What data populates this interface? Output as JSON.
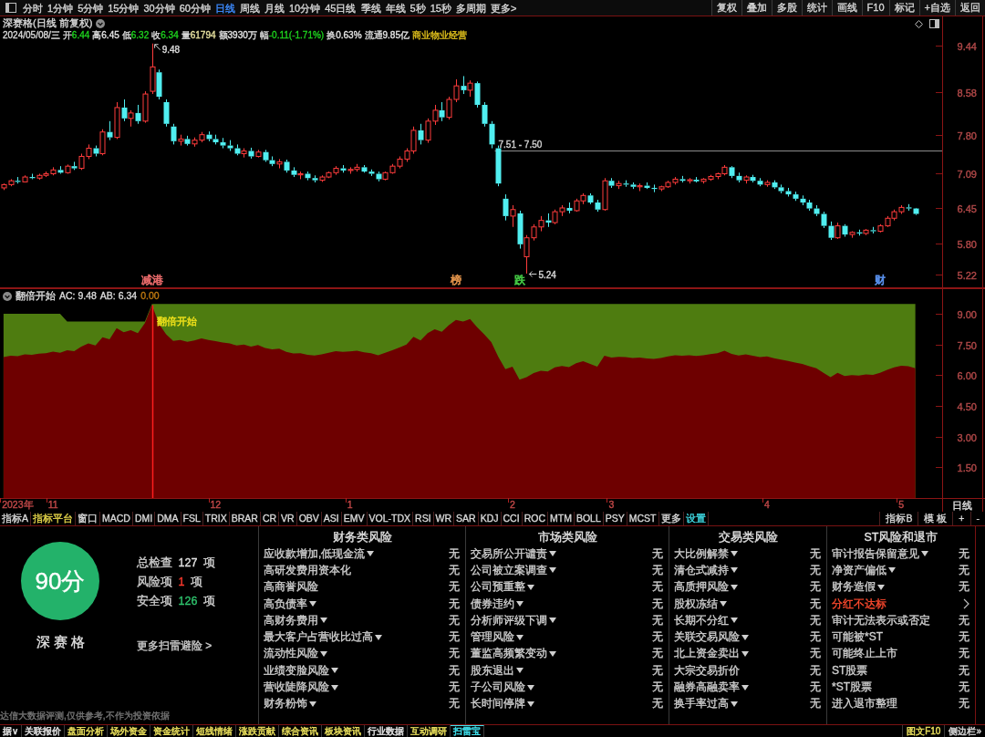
{
  "toolbar": {
    "periods": [
      {
        "label": "分时",
        "selected": false
      },
      {
        "label": "1分钟",
        "selected": false
      },
      {
        "label": "5分钟",
        "selected": false
      },
      {
        "label": "15分钟",
        "selected": false
      },
      {
        "label": "30分钟",
        "selected": false
      },
      {
        "label": "60分钟",
        "selected": false
      },
      {
        "label": "日线",
        "selected": true
      },
      {
        "label": "周线",
        "selected": false
      },
      {
        "label": "月线",
        "selected": false
      },
      {
        "label": "10分钟",
        "selected": false
      },
      {
        "label": "45日线",
        "selected": false
      },
      {
        "label": "季线",
        "selected": false
      },
      {
        "label": "年线",
        "selected": false
      },
      {
        "label": "5秒",
        "selected": false
      },
      {
        "label": "15秒",
        "selected": false
      },
      {
        "label": "多周期",
        "selected": false
      },
      {
        "label": "更多>",
        "selected": false
      }
    ],
    "buttons": [
      "复权",
      "叠加",
      "多股",
      "统计",
      "画线",
      "F10",
      "标记",
      "+自选",
      "返回"
    ]
  },
  "chart_header": {
    "title": "深赛格(日线 前复权)",
    "date": "2024/05/08/三",
    "quotes": [
      {
        "label": "开",
        "value": "6.44",
        "color": "#1ed21e"
      },
      {
        "label": "高",
        "value": "6.45",
        "color": "#e6e6e6"
      },
      {
        "label": "低",
        "value": "6.32",
        "color": "#1ed21e"
      },
      {
        "label": "收",
        "value": "6.34",
        "color": "#1ed21e"
      },
      {
        "label": "量",
        "value": "61794",
        "color": "#e8e2a0"
      },
      {
        "label": "额",
        "value": "3930万",
        "color": "#e6e6e6"
      },
      {
        "label": "幅",
        "value": "-0.11(-1.71%)",
        "color": "#1ed21e"
      },
      {
        "label": "换",
        "value": "0.63%",
        "color": "#e6e6e6"
      },
      {
        "label": "流通",
        "value": "9.85亿",
        "color": "#e6e6e6"
      }
    ],
    "industry": "商业物业经营"
  },
  "price_chart": {
    "chart_data": {
      "type": "candlestick",
      "ylim": [
        4.97,
        9.98
      ],
      "yticks": [
        9.44,
        8.58,
        {
          "value": 7.8,
          "label": "7.80"
        },
        7.09,
        6.45,
        {
          "value": 5.8,
          "label": "5.80"
        },
        5.22
      ],
      "categories": [
        null,
        null,
        null,
        null,
        null,
        null,
        null,
        null,
        null,
        null,
        null,
        null,
        null,
        null,
        null,
        null,
        null,
        null,
        null,
        null,
        null,
        "减港",
        null,
        null,
        null,
        null,
        null,
        null,
        null,
        null,
        null,
        null,
        null,
        null,
        null,
        null,
        null,
        null,
        null,
        null,
        null,
        null,
        null,
        null,
        null,
        null,
        null,
        null,
        null,
        null,
        null,
        null,
        null,
        null,
        null,
        null,
        null,
        null,
        null,
        null,
        null,
        null,
        null,
        null,
        "榜",
        null,
        null,
        null,
        null,
        null,
        null,
        null,
        null,
        "跌",
        null,
        null,
        null,
        null,
        null,
        null,
        null,
        null,
        null,
        null,
        null,
        null,
        null,
        null,
        null,
        null,
        null,
        null,
        null,
        null,
        null,
        null,
        null,
        null,
        null,
        null,
        null,
        null,
        null,
        null,
        null,
        null,
        null,
        null,
        null,
        null,
        null,
        null,
        null,
        null,
        null,
        null,
        null,
        null,
        null,
        null,
        null,
        null,
        null,
        null,
        "财",
        null,
        null,
        null,
        null,
        null
      ],
      "ohlc": [
        [
          6.82,
          6.9,
          6.78,
          6.88
        ],
        [
          6.88,
          6.98,
          6.85,
          6.95
        ],
        [
          6.95,
          7.02,
          6.9,
          6.93
        ],
        [
          6.93,
          7.05,
          6.92,
          7.02
        ],
        [
          7.02,
          7.08,
          6.98,
          7.0
        ],
        [
          7.0,
          7.08,
          6.97,
          7.05
        ],
        [
          7.05,
          7.12,
          7.02,
          7.08
        ],
        [
          7.08,
          7.2,
          7.05,
          7.15
        ],
        [
          7.15,
          7.22,
          7.08,
          7.1
        ],
        [
          7.1,
          7.25,
          7.08,
          7.22
        ],
        [
          7.22,
          7.3,
          7.15,
          7.18
        ],
        [
          7.18,
          7.45,
          7.15,
          7.4
        ],
        [
          7.4,
          7.62,
          7.35,
          7.55
        ],
        [
          7.55,
          7.6,
          7.4,
          7.45
        ],
        [
          7.45,
          7.9,
          7.42,
          7.85
        ],
        [
          7.85,
          8.05,
          7.7,
          7.75
        ],
        [
          7.75,
          8.4,
          7.72,
          8.3
        ],
        [
          8.3,
          8.45,
          8.05,
          8.1
        ],
        [
          8.1,
          8.25,
          7.95,
          8.2
        ],
        [
          8.2,
          8.35,
          8.0,
          8.05
        ],
        [
          8.05,
          8.6,
          8.02,
          8.55
        ],
        [
          8.6,
          9.48,
          8.55,
          9.05
        ],
        [
          8.95,
          9.0,
          8.45,
          8.5
        ],
        [
          8.4,
          8.45,
          7.95,
          8.0
        ],
        [
          7.95,
          8.0,
          7.62,
          7.68
        ],
        [
          7.68,
          7.8,
          7.6,
          7.72
        ],
        [
          7.72,
          7.78,
          7.6,
          7.63
        ],
        [
          7.63,
          7.75,
          7.58,
          7.7
        ],
        [
          7.7,
          7.85,
          7.66,
          7.8
        ],
        [
          7.8,
          7.86,
          7.68,
          7.72
        ],
        [
          7.72,
          7.8,
          7.62,
          7.66
        ],
        [
          7.66,
          7.74,
          7.55,
          7.6
        ],
        [
          7.6,
          7.7,
          7.5,
          7.55
        ],
        [
          7.55,
          7.62,
          7.42,
          7.45
        ],
        [
          7.45,
          7.55,
          7.38,
          7.5
        ],
        [
          7.5,
          7.56,
          7.36,
          7.4
        ],
        [
          7.4,
          7.52,
          7.38,
          7.48
        ],
        [
          7.48,
          7.52,
          7.3,
          7.33
        ],
        [
          7.33,
          7.4,
          7.22,
          7.26
        ],
        [
          7.26,
          7.35,
          7.18,
          7.3
        ],
        [
          7.3,
          7.34,
          7.1,
          7.14
        ],
        [
          7.14,
          7.2,
          7.02,
          7.06
        ],
        [
          7.06,
          7.12,
          6.98,
          7.08
        ],
        [
          7.08,
          7.12,
          6.96,
          7.0
        ],
        [
          7.0,
          7.05,
          6.92,
          6.96
        ],
        [
          6.96,
          7.05,
          6.93,
          7.02
        ],
        [
          7.02,
          7.12,
          7.0,
          7.1
        ],
        [
          7.1,
          7.22,
          7.06,
          7.18
        ],
        [
          7.18,
          7.24,
          7.1,
          7.14
        ],
        [
          7.14,
          7.2,
          7.08,
          7.16
        ],
        [
          7.16,
          7.26,
          7.12,
          7.2
        ],
        [
          7.2,
          7.24,
          7.1,
          7.12
        ],
        [
          7.12,
          7.16,
          7.04,
          7.08
        ],
        [
          7.08,
          7.12,
          6.94,
          6.98
        ],
        [
          6.98,
          7.12,
          6.96,
          7.1
        ],
        [
          7.1,
          7.26,
          7.08,
          7.22
        ],
        [
          7.22,
          7.4,
          7.18,
          7.35
        ],
        [
          7.35,
          7.55,
          7.3,
          7.5
        ],
        [
          7.5,
          7.95,
          7.45,
          7.88
        ],
        [
          7.88,
          8.0,
          7.62,
          7.7
        ],
        [
          7.7,
          8.1,
          7.65,
          8.05
        ],
        [
          8.05,
          8.35,
          7.98,
          8.25
        ],
        [
          8.25,
          8.4,
          8.05,
          8.12
        ],
        [
          8.12,
          8.5,
          8.08,
          8.45
        ],
        [
          8.45,
          8.82,
          8.4,
          8.7
        ],
        [
          8.7,
          8.88,
          8.55,
          8.62
        ],
        [
          8.62,
          8.8,
          8.5,
          8.75
        ],
        [
          8.75,
          8.78,
          8.3,
          8.35
        ],
        [
          8.35,
          8.4,
          7.95,
          8.0
        ],
        [
          8.0,
          8.05,
          7.55,
          7.62
        ],
        [
          7.55,
          7.6,
          6.85,
          6.9
        ],
        [
          6.62,
          6.7,
          6.22,
          6.3
        ],
        [
          6.3,
          6.5,
          6.1,
          6.42
        ],
        [
          6.35,
          6.4,
          5.7,
          5.78
        ],
        [
          5.55,
          5.95,
          5.24,
          5.9
        ],
        [
          5.9,
          6.15,
          5.85,
          6.1
        ],
        [
          6.1,
          6.3,
          6.02,
          6.22
        ],
        [
          6.22,
          6.35,
          6.1,
          6.18
        ],
        [
          6.18,
          6.42,
          6.15,
          6.38
        ],
        [
          6.38,
          6.5,
          6.3,
          6.45
        ],
        [
          6.45,
          6.55,
          6.35,
          6.4
        ],
        [
          6.4,
          6.62,
          6.38,
          6.58
        ],
        [
          6.58,
          6.72,
          6.52,
          6.68
        ],
        [
          6.68,
          6.72,
          6.52,
          6.55
        ],
        [
          6.55,
          6.6,
          6.38,
          6.42
        ],
        [
          6.42,
          7.0,
          6.4,
          6.95
        ],
        [
          6.95,
          7.0,
          6.82,
          6.86
        ],
        [
          6.86,
          6.95,
          6.8,
          6.9
        ],
        [
          6.9,
          6.96,
          6.84,
          6.88
        ],
        [
          6.88,
          6.92,
          6.8,
          6.84
        ],
        [
          6.84,
          6.9,
          6.76,
          6.86
        ],
        [
          6.86,
          6.92,
          6.8,
          6.82
        ],
        [
          6.82,
          6.88,
          6.74,
          6.8
        ],
        [
          6.8,
          6.86,
          6.76,
          6.84
        ],
        [
          6.84,
          6.95,
          6.82,
          6.92
        ],
        [
          6.92,
          7.02,
          6.88,
          6.98
        ],
        [
          6.98,
          7.04,
          6.92,
          6.95
        ],
        [
          6.95,
          7.0,
          6.9,
          6.97
        ],
        [
          6.97,
          7.02,
          6.92,
          6.94
        ],
        [
          6.94,
          7.0,
          6.9,
          6.98
        ],
        [
          6.98,
          7.06,
          6.95,
          7.03
        ],
        [
          7.03,
          7.1,
          6.98,
          7.08
        ],
        [
          7.08,
          7.24,
          7.05,
          7.2
        ],
        [
          7.2,
          7.22,
          7.0,
          7.04
        ],
        [
          7.04,
          7.1,
          6.92,
          6.96
        ],
        [
          6.96,
          7.05,
          6.9,
          7.02
        ],
        [
          7.02,
          7.06,
          6.92,
          6.95
        ],
        [
          6.95,
          7.0,
          6.85,
          6.88
        ],
        [
          6.88,
          6.96,
          6.84,
          6.92
        ],
        [
          6.92,
          6.96,
          6.8,
          6.83
        ],
        [
          6.83,
          6.88,
          6.72,
          6.76
        ],
        [
          6.76,
          6.82,
          6.66,
          6.7
        ],
        [
          6.7,
          6.75,
          6.58,
          6.62
        ],
        [
          6.62,
          6.68,
          6.5,
          6.55
        ],
        [
          6.55,
          6.6,
          6.4,
          6.44
        ],
        [
          6.44,
          6.5,
          6.3,
          6.34
        ],
        [
          6.34,
          6.38,
          6.08,
          6.12
        ],
        [
          6.12,
          6.2,
          5.86,
          5.9
        ],
        [
          5.9,
          6.18,
          5.88,
          6.12
        ],
        [
          6.12,
          6.15,
          5.92,
          5.96
        ],
        [
          5.96,
          6.02,
          5.9,
          6.0
        ],
        [
          6.0,
          6.05,
          5.94,
          5.98
        ],
        [
          5.98,
          6.06,
          5.95,
          6.04
        ],
        [
          6.04,
          6.1,
          5.98,
          6.02
        ],
        [
          6.02,
          6.15,
          6.0,
          6.12
        ],
        [
          6.12,
          6.3,
          6.1,
          6.26
        ],
        [
          6.26,
          6.42,
          6.22,
          6.38
        ],
        [
          6.38,
          6.5,
          6.34,
          6.46
        ],
        [
          6.46,
          6.52,
          6.4,
          6.44
        ],
        [
          6.44,
          6.45,
          6.32,
          6.34
        ]
      ],
      "ref_lines": [
        {
          "axis": "y",
          "value": 7.51,
          "label": "7.51 - 7.50",
          "color": "#8c8c8c"
        }
      ],
      "annotations": [
        "9.48",
        "5.24"
      ]
    },
    "event_markers": [
      {
        "color": "#e86a6a"
      },
      {
        "color": "#e0924a"
      },
      {
        "color": "#44c844"
      },
      {
        "color": "#5a92f0"
      }
    ]
  },
  "indicator": {
    "name": "翻倍开始",
    "readouts": [
      {
        "text": "AC: 9.48",
        "color": "#dcdcdc"
      },
      {
        "text": "AB: 6.34",
        "color": "#dcdcdc"
      },
      {
        "text": "0.00",
        "color": "#c07a10"
      }
    ],
    "chart_data": {
      "type": "area",
      "ylim": [
        0,
        10.25
      ],
      "yticks": [
        {
          "value": 9,
          "label": "9.00"
        },
        {
          "value": 7.5,
          "label": "7.50"
        },
        {
          "value": 6,
          "label": "6.00"
        },
        {
          "value": 4.5,
          "label": "4.50"
        },
        {
          "value": 3,
          "label": "3.00"
        },
        {
          "value": 1.5,
          "label": "1.50"
        }
      ],
      "categories": [
        null,
        null,
        "2023年",
        null,
        null,
        null,
        null,
        "11",
        null,
        null,
        null,
        null,
        null,
        null,
        null,
        null,
        null,
        null,
        null,
        null,
        null,
        null,
        null,
        null,
        null,
        null,
        null,
        null,
        null,
        null,
        "12",
        null,
        null,
        null,
        null,
        null,
        null,
        null,
        null,
        null,
        null,
        null,
        null,
        null,
        null,
        null,
        null,
        null,
        null,
        "1",
        null,
        null,
        null,
        null,
        null,
        null,
        null,
        null,
        null,
        null,
        null,
        null,
        null,
        null,
        null,
        null,
        null,
        null,
        null,
        null,
        null,
        null,
        "2",
        null,
        null,
        null,
        null,
        null,
        null,
        null,
        null,
        null,
        null,
        null,
        null,
        null,
        "3",
        null,
        null,
        null,
        null,
        null,
        null,
        null,
        null,
        null,
        null,
        null,
        null,
        null,
        null,
        null,
        null,
        null,
        null,
        null,
        null,
        null,
        "4",
        null,
        null,
        null,
        null,
        null,
        null,
        null,
        null,
        null,
        null,
        null,
        null,
        null,
        null,
        null,
        null,
        null,
        null,
        "5",
        null,
        null
      ],
      "series": [
        {
          "color": "#4e7c10",
          "values": [
            9,
            9,
            9,
            9,
            9,
            9,
            9,
            9,
            9,
            8.62,
            8.62,
            8.62,
            8.62,
            8.62,
            8.62,
            8.62,
            8.62,
            8.62,
            8.62,
            8.62,
            8.62,
            9.48,
            9.48,
            9.48,
            9.48,
            9.48,
            9.48,
            9.48,
            9.48,
            9.48,
            9.48,
            9.48,
            9.48,
            9.48,
            9.48,
            9.48,
            9.48,
            9.48,
            9.48,
            9.48,
            9.48,
            9.48,
            9.48,
            9.48,
            9.48,
            9.48,
            9.48,
            9.48,
            9.48,
            9.48,
            9.48,
            9.48,
            9.48,
            9.48,
            9.48,
            9.48,
            9.48,
            9.48,
            9.48,
            9.48,
            9.48,
            9.48,
            9.48,
            9.48,
            9.48,
            9.48,
            9.48,
            9.48,
            9.48,
            9.48,
            9.48,
            9.48,
            9.48,
            9.48,
            9.48,
            9.48,
            9.48,
            9.48,
            9.48,
            9.48,
            9.48,
            9.48,
            9.48,
            9.48,
            9.48,
            9.48,
            9.48,
            9.48,
            9.48,
            9.48,
            9.48,
            9.48,
            9.48,
            9.48,
            9.48,
            9.48,
            9.48,
            9.48,
            9.48,
            9.48,
            9.48,
            9.48,
            9.48,
            9.48,
            9.48,
            9.48,
            9.48,
            9.48,
            9.48,
            9.48,
            9.48,
            9.48,
            9.48,
            9.48,
            9.48,
            9.48,
            9.48,
            9.48,
            9.48,
            9.48,
            9.48,
            9.48,
            9.48,
            9.48,
            9.48,
            9.48,
            9.48,
            9.48,
            9.48,
            9.48
          ]
        },
        {
          "color": "#6e0000",
          "values": [
            6.88,
            6.95,
            6.93,
            7.02,
            7.0,
            7.05,
            7.08,
            7.15,
            7.1,
            7.22,
            7.18,
            7.4,
            7.55,
            7.45,
            7.85,
            7.75,
            8.3,
            8.1,
            8.2,
            8.05,
            8.55,
            9.42,
            8.5,
            8.0,
            7.68,
            7.72,
            7.63,
            7.7,
            7.8,
            7.72,
            7.66,
            7.6,
            7.55,
            7.45,
            7.5,
            7.4,
            7.48,
            7.33,
            7.26,
            7.3,
            7.14,
            7.06,
            7.08,
            7.0,
            6.96,
            7.02,
            7.1,
            7.18,
            7.14,
            7.16,
            7.2,
            7.12,
            7.08,
            6.98,
            7.1,
            7.22,
            7.35,
            7.5,
            7.88,
            7.7,
            8.05,
            8.25,
            8.12,
            8.45,
            8.7,
            8.62,
            8.75,
            8.35,
            8.0,
            7.62,
            6.9,
            6.3,
            6.42,
            5.78,
            5.9,
            6.1,
            6.22,
            6.18,
            6.38,
            6.45,
            6.4,
            6.58,
            6.68,
            6.55,
            6.42,
            6.95,
            6.86,
            6.9,
            6.88,
            6.84,
            6.86,
            6.82,
            6.8,
            6.84,
            6.92,
            6.98,
            6.95,
            6.97,
            6.94,
            6.98,
            7.03,
            7.08,
            7.2,
            7.04,
            6.96,
            7.02,
            6.95,
            6.88,
            6.92,
            6.83,
            6.76,
            6.7,
            6.62,
            6.55,
            6.44,
            6.34,
            6.12,
            5.9,
            6.12,
            5.96,
            6.0,
            5.98,
            6.04,
            6.02,
            6.12,
            6.26,
            6.38,
            6.46,
            6.44,
            6.34
          ]
        }
      ],
      "annotations": [
        "翻倍开始"
      ]
    },
    "period_label": "日线"
  },
  "indicator_bar": {
    "items": [
      {
        "label": "指标A",
        "color": "#d8d8d8"
      },
      {
        "label": "指标平台",
        "color": "#e6d64a"
      },
      {
        "label": "窗口",
        "color": "#d8d8d8"
      },
      {
        "label": "MACD",
        "color": "#d8d8d8"
      },
      {
        "label": "DMI",
        "color": "#d8d8d8"
      },
      {
        "label": "DMA",
        "color": "#d8d8d8"
      },
      {
        "label": "FSL",
        "color": "#d8d8d8"
      },
      {
        "label": "TRIX",
        "color": "#d8d8d8"
      },
      {
        "label": "BRAR",
        "color": "#d8d8d8"
      },
      {
        "label": "CR",
        "color": "#d8d8d8"
      },
      {
        "label": "VR",
        "color": "#d8d8d8"
      },
      {
        "label": "OBV",
        "color": "#d8d8d8"
      },
      {
        "label": "ASI",
        "color": "#d8d8d8"
      },
      {
        "label": "EMV",
        "color": "#d8d8d8"
      },
      {
        "label": "VOL-TDX",
        "color": "#d8d8d8"
      },
      {
        "label": "RSI",
        "color": "#d8d8d8"
      },
      {
        "label": "WR",
        "color": "#d8d8d8"
      },
      {
        "label": "SAR",
        "color": "#d8d8d8"
      },
      {
        "label": "KDJ",
        "color": "#d8d8d8"
      },
      {
        "label": "CCI",
        "color": "#d8d8d8"
      },
      {
        "label": "ROC",
        "color": "#d8d8d8"
      },
      {
        "label": "MTM",
        "color": "#d8d8d8"
      },
      {
        "label": "BOLL",
        "color": "#d8d8d8"
      },
      {
        "label": "PSY",
        "color": "#d8d8d8"
      },
      {
        "label": "MCST",
        "color": "#d8d8d8"
      },
      {
        "label": "更多",
        "color": "#d8d8d8"
      },
      {
        "label": "设置",
        "color": "#3ed6e0"
      }
    ],
    "right": [
      "指标B",
      "模 板",
      "+",
      "-"
    ]
  },
  "risk_panel": {
    "score": "90分",
    "stock": "深赛格",
    "stats": [
      {
        "label": "总检查",
        "value": "127",
        "unit": "项",
        "color": "#e2e2e2"
      },
      {
        "label": "风险项",
        "value": "1",
        "unit": "项",
        "color": "#ff3a2e"
      },
      {
        "label": "安全项",
        "value": "126",
        "unit": "项",
        "color": "#2fc46e"
      }
    ],
    "more_link": "更多扫雷避险 >",
    "disclaimer": "达信大数据评测,仅供参考,不作为投资依据",
    "columns": [
      {
        "title": "财务类风险",
        "items": [
          {
            "label": "应收款增加,低现金流",
            "dropdown": true,
            "flagged": false,
            "result": "无"
          },
          {
            "label": "高研发费用资本化",
            "dropdown": false,
            "flagged": false,
            "result": "无"
          },
          {
            "label": "高商誉风险",
            "dropdown": false,
            "flagged": false,
            "result": "无"
          },
          {
            "label": "高负债率",
            "dropdown": true,
            "flagged": false,
            "result": "无"
          },
          {
            "label": "高财务费用",
            "dropdown": true,
            "flagged": false,
            "result": "无"
          },
          {
            "label": "最大客户占营收比过高",
            "dropdown": true,
            "flagged": false,
            "result": "无"
          },
          {
            "label": "流动性风险",
            "dropdown": true,
            "flagged": false,
            "result": "无"
          },
          {
            "label": "业绩变脸风险",
            "dropdown": true,
            "flagged": false,
            "result": "无"
          },
          {
            "label": "营收陡降风险",
            "dropdown": true,
            "flagged": false,
            "result": "无"
          },
          {
            "label": "财务粉饰",
            "dropdown": true,
            "flagged": false,
            "result": "无"
          }
        ]
      },
      {
        "title": "市场类风险",
        "items": [
          {
            "label": "交易所公开谴责",
            "dropdown": true,
            "flagged": false,
            "result": "无"
          },
          {
            "label": "公司被立案调查",
            "dropdown": true,
            "flagged": false,
            "result": "无"
          },
          {
            "label": "公司预重整",
            "dropdown": true,
            "flagged": false,
            "result": "无"
          },
          {
            "label": "债券违约",
            "dropdown": true,
            "flagged": false,
            "result": "无"
          },
          {
            "label": "分析师评级下调",
            "dropdown": true,
            "flagged": false,
            "result": "无"
          },
          {
            "label": "管理风险",
            "dropdown": true,
            "flagged": false,
            "result": "无"
          },
          {
            "label": "董监高频繁变动",
            "dropdown": true,
            "flagged": false,
            "result": "无"
          },
          {
            "label": "股东退出",
            "dropdown": true,
            "flagged": false,
            "result": "无"
          },
          {
            "label": "子公司风险",
            "dropdown": true,
            "flagged": false,
            "result": "无"
          },
          {
            "label": "长时间停牌",
            "dropdown": true,
            "flagged": false,
            "result": "无"
          }
        ]
      },
      {
        "title": "交易类风险",
        "items": [
          {
            "label": "大比例解禁",
            "dropdown": true,
            "flagged": false,
            "result": "无"
          },
          {
            "label": "清仓式减持",
            "dropdown": true,
            "flagged": false,
            "result": "无"
          },
          {
            "label": "高质押风险",
            "dropdown": true,
            "flagged": false,
            "result": "无"
          },
          {
            "label": "股权冻结",
            "dropdown": true,
            "flagged": false,
            "result": "无"
          },
          {
            "label": "长期不分红",
            "dropdown": true,
            "flagged": false,
            "result": "无"
          },
          {
            "label": "关联交易风险",
            "dropdown": true,
            "flagged": false,
            "result": "无"
          },
          {
            "label": "北上资金卖出",
            "dropdown": true,
            "flagged": false,
            "result": "无"
          },
          {
            "label": "大宗交易折价",
            "dropdown": false,
            "flagged": false,
            "result": "无"
          },
          {
            "label": "融券高融卖率",
            "dropdown": true,
            "flagged": false,
            "result": "无"
          },
          {
            "label": "换手率过高",
            "dropdown": true,
            "flagged": false,
            "result": "无"
          }
        ]
      },
      {
        "title": "ST风险和退市",
        "items": [
          {
            "label": "审计报告保留意见",
            "dropdown": true,
            "flagged": false,
            "result": "无"
          },
          {
            "label": "净资产偏低",
            "dropdown": true,
            "flagged": false,
            "result": "无"
          },
          {
            "label": "财务造假",
            "dropdown": true,
            "flagged": false,
            "result": "无"
          },
          {
            "label": "分红不达标",
            "dropdown": false,
            "flagged": true
          },
          {
            "label": "审计无法表示或否定",
            "dropdown": false,
            "flagged": false,
            "result": "无"
          },
          {
            "label": "可能被*ST",
            "dropdown": false,
            "flagged": false,
            "result": "无"
          },
          {
            "label": "可能终止上市",
            "dropdown": false,
            "flagged": false,
            "result": "无"
          },
          {
            "label": "ST股票",
            "dropdown": false,
            "flagged": false,
            "result": "无"
          },
          {
            "label": "*ST股票",
            "dropdown": false,
            "flagged": false,
            "result": "无"
          },
          {
            "label": "进入退市整理",
            "dropdown": false,
            "flagged": false,
            "result": "无"
          }
        ]
      }
    ]
  },
  "bottom_tabs": {
    "tabs": [
      {
        "label": "据∨",
        "color": "#e0e0e0",
        "selected": false
      },
      {
        "label": "关联报价",
        "color": "#e0e0e0",
        "selected": false
      },
      {
        "label": "盘面分析",
        "color": "#e6dc5a",
        "selected": false
      },
      {
        "label": "场外资金",
        "color": "#e6dc5a",
        "selected": false
      },
      {
        "label": "资金统计",
        "color": "#e6dc5a",
        "selected": false
      },
      {
        "label": "短线情绪",
        "color": "#e6dc5a",
        "selected": false
      },
      {
        "label": "涨跌贡献",
        "color": "#e6dc5a",
        "selected": false
      },
      {
        "label": "综合资讯",
        "color": "#e6dc5a",
        "selected": false
      },
      {
        "label": "板块资讯",
        "color": "#e6dc5a",
        "selected": false
      },
      {
        "label": "行业数据",
        "color": "#e0e0e0",
        "selected": false
      },
      {
        "label": "互动调研",
        "color": "#e6dc5a",
        "selected": false
      },
      {
        "label": "扫雷宝",
        "color": "#3ee0ee",
        "selected": true
      }
    ],
    "right": [
      {
        "label": "图文F10",
        "color": "#e6dc5a"
      },
      {
        "label": "侧边栏»",
        "color": "#d0d0d0"
      }
    ]
  }
}
